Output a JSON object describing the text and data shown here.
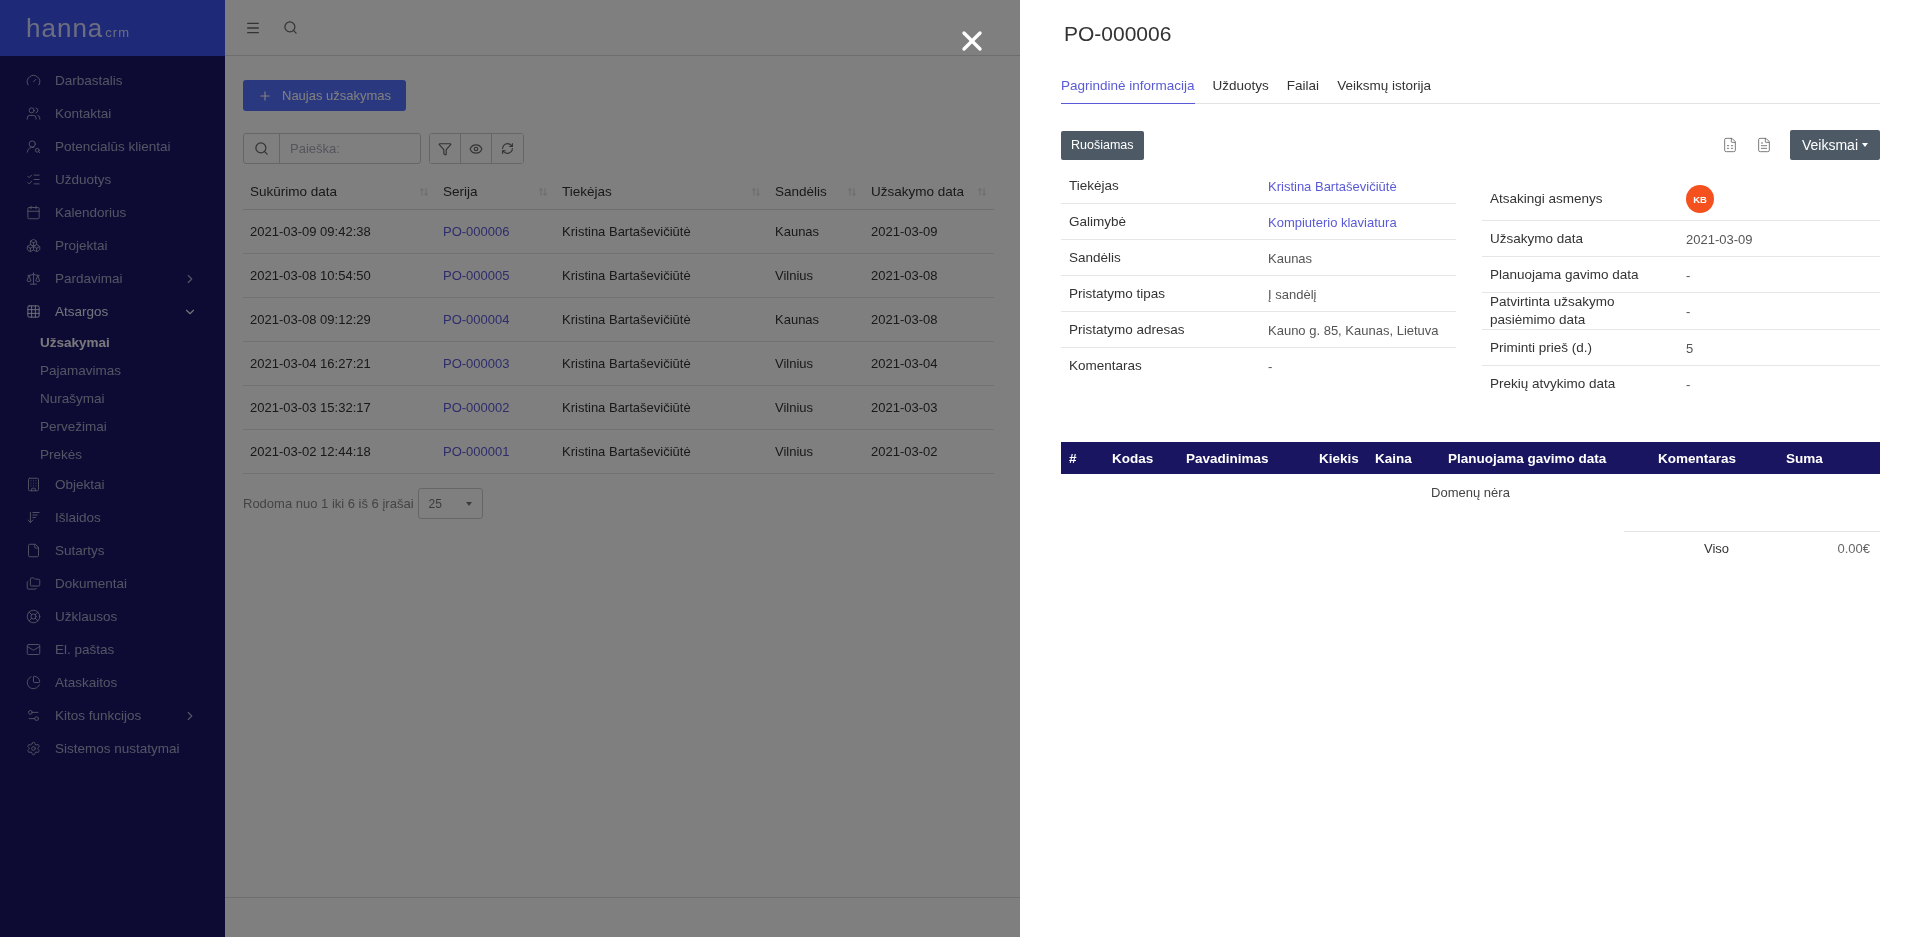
{
  "logo": {
    "name": "hanna",
    "suffix": "crm"
  },
  "sidebar": {
    "items": [
      {
        "label": "Darbastalis",
        "expandable": false,
        "expanded": false
      },
      {
        "label": "Kontaktai",
        "expandable": false,
        "expanded": false
      },
      {
        "label": "Potencialūs klientai",
        "expandable": false,
        "expanded": false
      },
      {
        "label": "Užduotys",
        "expandable": false,
        "expanded": false
      },
      {
        "label": "Kalendorius",
        "expandable": false,
        "expanded": false
      },
      {
        "label": "Projektai",
        "expandable": false,
        "expanded": false
      },
      {
        "label": "Pardavimai",
        "expandable": true,
        "expanded": false
      },
      {
        "label": "Atsargos",
        "expandable": true,
        "expanded": true,
        "children": [
          {
            "label": "Užsakymai",
            "selected": true
          },
          {
            "label": "Pajamavimas",
            "selected": false
          },
          {
            "label": "Nurašymai",
            "selected": false
          },
          {
            "label": "Pervežimai",
            "selected": false
          },
          {
            "label": "Prekės",
            "selected": false
          }
        ]
      },
      {
        "label": "Objektai",
        "expandable": false,
        "expanded": false
      },
      {
        "label": "Išlaidos",
        "expandable": false,
        "expanded": false
      },
      {
        "label": "Sutartys",
        "expandable": false,
        "expanded": false
      },
      {
        "label": "Dokumentai",
        "expandable": false,
        "expanded": false
      },
      {
        "label": "Užklausos",
        "expandable": false,
        "expanded": false
      },
      {
        "label": "El. paštas",
        "expandable": false,
        "expanded": false
      },
      {
        "label": "Ataskaitos",
        "expandable": false,
        "expanded": false
      },
      {
        "label": "Kitos funkcijos",
        "expandable": true,
        "expanded": false
      },
      {
        "label": "Sistemos nustatymai",
        "expandable": false,
        "expanded": false
      }
    ]
  },
  "list": {
    "new_button": "Naujas užsakymas",
    "search": {
      "placeholder": "Paieška:"
    },
    "table": {
      "columns": [
        "Sukūrimo data",
        "Serija",
        "Tiekėjas",
        "Sandėlis",
        "Užsakymo data"
      ],
      "rows": [
        [
          "2021-03-09 09:42:38",
          "PO-000006",
          "Kristina Bartaševičiūtė",
          "Kaunas",
          "2021-03-09"
        ],
        [
          "2021-03-08 10:54:50",
          "PO-000005",
          "Kristina Bartaševičiūtė",
          "Vilnius",
          "2021-03-08"
        ],
        [
          "2021-03-08 09:12:29",
          "PO-000004",
          "Kristina Bartaševičiūtė",
          "Kaunas",
          "2021-03-08"
        ],
        [
          "2021-03-04 16:27:21",
          "PO-000003",
          "Kristina Bartaševičiūtė",
          "Vilnius",
          "2021-03-04"
        ],
        [
          "2021-03-03 15:32:17",
          "PO-000002",
          "Kristina Bartaševičiūtė",
          "Vilnius",
          "2021-03-03"
        ],
        [
          "2021-03-02 12:44:18",
          "PO-000001",
          "Kristina Bartaševičiūtė",
          "Vilnius",
          "2021-03-02"
        ]
      ]
    },
    "footer": {
      "summary": "Rodoma nuo 1 iki 6 iš 6 įrašai",
      "page_size": "25"
    }
  },
  "drawer": {
    "title": "PO-000006",
    "tabs": [
      {
        "label": "Pagrindinė informacija",
        "selected": true
      },
      {
        "label": "Užduotys",
        "selected": false
      },
      {
        "label": "Failai",
        "selected": false
      },
      {
        "label": "Veiksmų istorija",
        "selected": false
      }
    ],
    "status": "Ruošiamas",
    "actions_button": "Veiksmai",
    "left_fields": [
      {
        "label": "Tiekėjas",
        "value": "Kristina Bartaševičiūtė",
        "kind": "link"
      },
      {
        "label": "Galimybė",
        "value": "Kompiuterio klaviatura",
        "kind": "link"
      },
      {
        "label": "Sandėlis",
        "value": "Kaunas",
        "kind": "text"
      },
      {
        "label": "Pristatymo tipas",
        "value": "Į sandėlį",
        "kind": "text"
      },
      {
        "label": "Pristatymo adresas",
        "value": "Kauno g. 85, Kaunas, Lietuva",
        "kind": "text"
      },
      {
        "label": "Komentaras",
        "value": "-",
        "kind": "text"
      }
    ],
    "right_fields": [
      {
        "label": "Atsakingi asmenys",
        "value": "KB",
        "kind": "avatar"
      },
      {
        "label": "Užsakymo data",
        "value": "2021-03-09",
        "kind": "text"
      },
      {
        "label": "Planuojama gavimo data",
        "value": "-",
        "kind": "text"
      },
      {
        "label": "Patvirtinta užsakymo pasiėmimo data",
        "value": "-",
        "kind": "text"
      },
      {
        "label": "Priminti prieš (d.)",
        "value": "5",
        "kind": "text"
      },
      {
        "label": "Prekių atvykimo data",
        "value": "-",
        "kind": "text"
      }
    ],
    "items_table": {
      "columns": [
        "#",
        "Kodas",
        "Pavadinimas",
        "Kiekis",
        "Kaina",
        "Planuojama gavimo data",
        "Komentaras",
        "Suma"
      ],
      "empty": "Domenų nėra"
    },
    "total": {
      "label": "Viso",
      "value": "0.00€"
    }
  }
}
